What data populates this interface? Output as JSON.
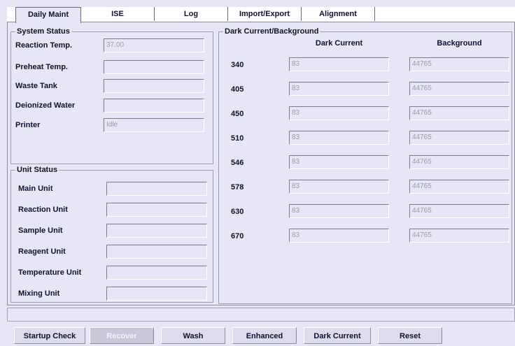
{
  "tabs": [
    {
      "label": "Daily Maint",
      "active": true
    },
    {
      "label": "ISE",
      "active": false
    },
    {
      "label": "Log",
      "active": false
    },
    {
      "label": "Import/Export",
      "active": false
    },
    {
      "label": "Alignment",
      "active": false
    }
  ],
  "system_status": {
    "title": "System Status",
    "rows": [
      {
        "label": "Reaction Temp.",
        "value": "37.00"
      },
      {
        "label": "Preheat Temp.",
        "value": ""
      },
      {
        "label": "Waste Tank",
        "value": ""
      },
      {
        "label": "Deionized Water",
        "value": ""
      },
      {
        "label": "Printer",
        "value": "Idle"
      }
    ]
  },
  "unit_status": {
    "title": "Unit Status",
    "rows": [
      {
        "label": "Main Unit",
        "value": ""
      },
      {
        "label": "Reaction Unit",
        "value": ""
      },
      {
        "label": "Sample Unit",
        "value": ""
      },
      {
        "label": "Reagent Unit",
        "value": ""
      },
      {
        "label": "Temperature Unit",
        "value": ""
      },
      {
        "label": "Mixing Unit",
        "value": ""
      }
    ]
  },
  "dark_current": {
    "title": "Dark Current/Background",
    "col_dark": "Dark Current",
    "col_bg": "Background",
    "rows": [
      {
        "wl": "340",
        "dark": "83",
        "bg": "44765"
      },
      {
        "wl": "405",
        "dark": "83",
        "bg": "44765"
      },
      {
        "wl": "450",
        "dark": "83",
        "bg": "44765"
      },
      {
        "wl": "510",
        "dark": "83",
        "bg": "44765"
      },
      {
        "wl": "546",
        "dark": "83",
        "bg": "44765"
      },
      {
        "wl": "578",
        "dark": "83",
        "bg": "44765"
      },
      {
        "wl": "630",
        "dark": "83",
        "bg": "44765"
      },
      {
        "wl": "670",
        "dark": "83",
        "bg": "44765"
      }
    ]
  },
  "status_bar": {
    "text": ""
  },
  "buttons": [
    {
      "label": "Startup Check",
      "enabled": true
    },
    {
      "label": "Recover",
      "enabled": false
    },
    {
      "label": "Wash",
      "enabled": true
    },
    {
      "label": "Enhanced",
      "enabled": true
    },
    {
      "label": "Dark Current",
      "enabled": true
    },
    {
      "label": "Reset",
      "enabled": true
    }
  ]
}
